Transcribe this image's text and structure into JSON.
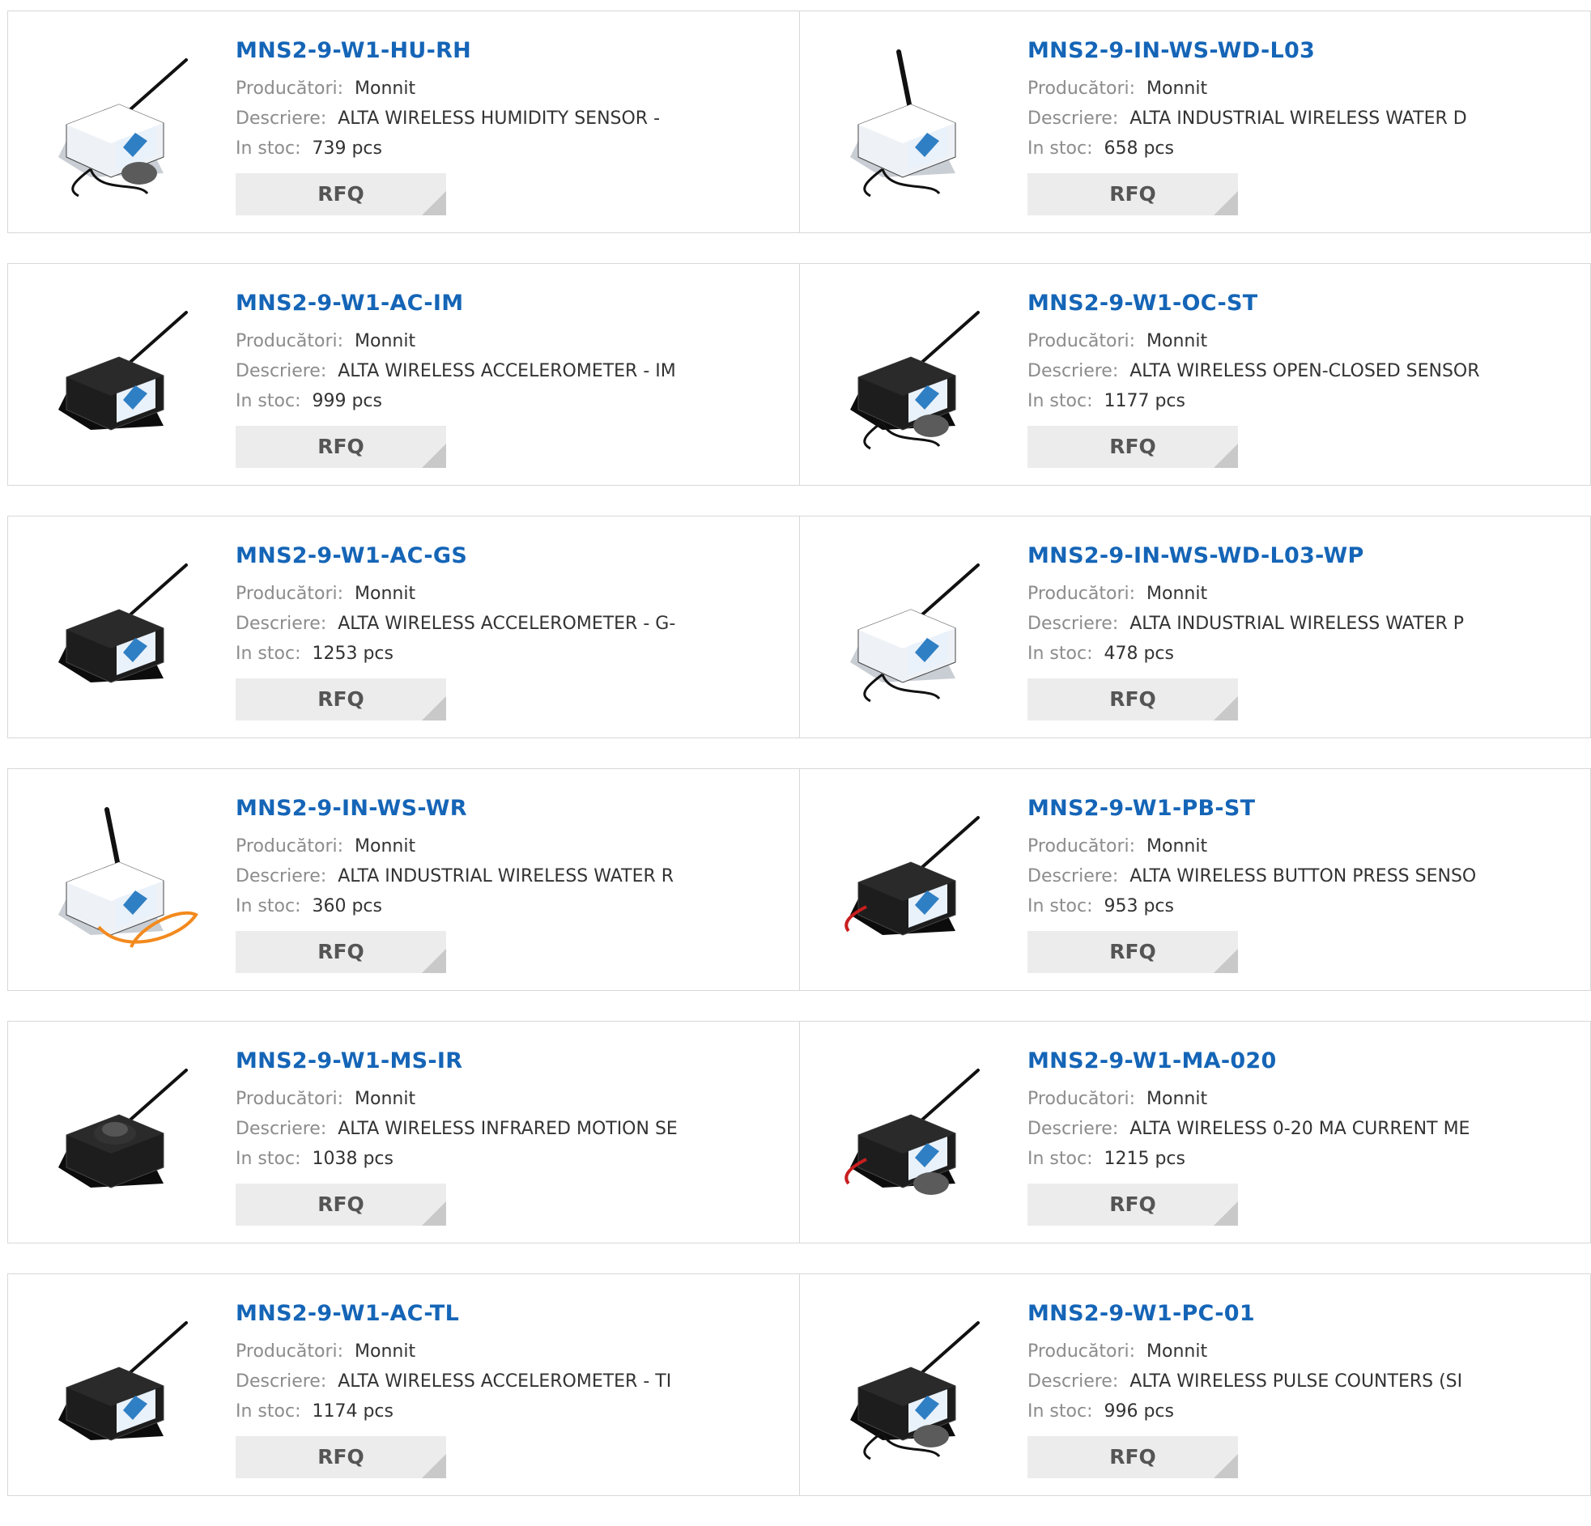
{
  "labels": {
    "manufacturer": "Producători:",
    "description": "Descriere:",
    "stock": "In stoc:",
    "rfq": "RFQ"
  },
  "products": [
    {
      "part": "MNS2-9-W1-HU-RH",
      "manufacturer": "Monnit",
      "description": "ALTA WIRELESS HUMIDITY SENSOR -",
      "stock": "739 pcs",
      "image_icon": "humidity-sensor-icon"
    },
    {
      "part": "MNS2-9-IN-WS-WD-L03",
      "manufacturer": "Monnit",
      "description": "ALTA INDUSTRIAL WIRELESS WATER D",
      "stock": "658 pcs",
      "image_icon": "water-detection-sensor-icon"
    },
    {
      "part": "MNS2-9-W1-AC-IM",
      "manufacturer": "Monnit",
      "description": "ALTA WIRELESS ACCELEROMETER - IM",
      "stock": "999 pcs",
      "image_icon": "accelerometer-sensor-icon"
    },
    {
      "part": "MNS2-9-W1-OC-ST",
      "manufacturer": "Monnit",
      "description": "ALTA WIRELESS OPEN-CLOSED SENSOR",
      "stock": "1177 pcs",
      "image_icon": "open-closed-sensor-icon"
    },
    {
      "part": "MNS2-9-W1-AC-GS",
      "manufacturer": "Monnit",
      "description": "ALTA WIRELESS ACCELEROMETER - G-",
      "stock": "1253 pcs",
      "image_icon": "accelerometer-sensor-icon"
    },
    {
      "part": "MNS2-9-IN-WS-WD-L03-WP",
      "manufacturer": "Monnit",
      "description": "ALTA INDUSTRIAL WIRELESS WATER P",
      "stock": "478 pcs",
      "image_icon": "water-probe-sensor-icon"
    },
    {
      "part": "MNS2-9-IN-WS-WR",
      "manufacturer": "Monnit",
      "description": "ALTA INDUSTRIAL WIRELESS WATER R",
      "stock": "360 pcs",
      "image_icon": "water-rope-sensor-icon"
    },
    {
      "part": "MNS2-9-W1-PB-ST",
      "manufacturer": "Monnit",
      "description": "ALTA WIRELESS BUTTON PRESS SENSO",
      "stock": "953 pcs",
      "image_icon": "button-press-sensor-icon"
    },
    {
      "part": "MNS2-9-W1-MS-IR",
      "manufacturer": "Monnit",
      "description": "ALTA WIRELESS INFRARED MOTION SE",
      "stock": "1038 pcs",
      "image_icon": "motion-sensor-icon"
    },
    {
      "part": "MNS2-9-W1-MA-020",
      "manufacturer": "Monnit",
      "description": "ALTA WIRELESS 0-20 MA CURRENT ME",
      "stock": "1215 pcs",
      "image_icon": "current-meter-sensor-icon"
    },
    {
      "part": "MNS2-9-W1-AC-TL",
      "manufacturer": "Monnit",
      "description": "ALTA WIRELESS ACCELEROMETER - TI",
      "stock": "1174 pcs",
      "image_icon": "accelerometer-sensor-icon"
    },
    {
      "part": "MNS2-9-W1-PC-01",
      "manufacturer": "Monnit",
      "description": "ALTA WIRELESS PULSE COUNTERS (SI",
      "stock": "996 pcs",
      "image_icon": "pulse-counter-sensor-icon"
    }
  ]
}
